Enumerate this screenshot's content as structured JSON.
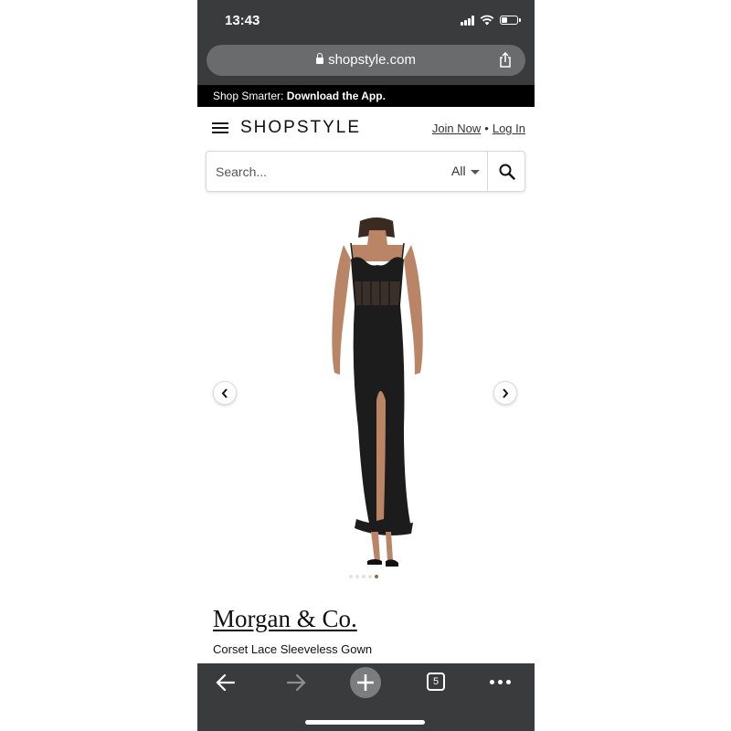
{
  "status_bar": {
    "time": "13:43"
  },
  "browser": {
    "url": "shopstyle.com",
    "tab_count": "5"
  },
  "promo": {
    "lead": "Shop Smarter: ",
    "cta": "Download the App."
  },
  "header": {
    "logo": "SHOPSTYLE",
    "join": "Join Now",
    "separator": "•",
    "login": "Log In"
  },
  "search": {
    "placeholder": "Search...",
    "scope": "All"
  },
  "gallery": {
    "image_count": 5,
    "active_index": 4
  },
  "product": {
    "brand": "Morgan & Co.",
    "name": "Corset Lace Sleeveless Gown"
  },
  "icons": [
    "menu-icon",
    "search-icon",
    "chevron-left-icon",
    "chevron-right-icon",
    "back-arrow-icon",
    "forward-arrow-icon",
    "plus-icon",
    "more-icon",
    "share-icon",
    "lock-icon",
    "wifi-icon",
    "signal-icon",
    "battery-icon"
  ],
  "colors": {
    "chrome": "#3a3b3c",
    "promo_bg": "#000000",
    "active_dot": "#8a6d3b",
    "dress": "#1c1c1c"
  }
}
